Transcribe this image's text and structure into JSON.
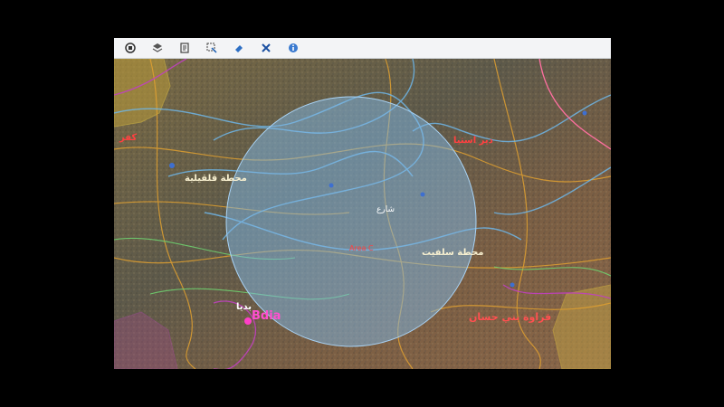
{
  "toolbar": {
    "tools": [
      {
        "icon": "home-icon"
      },
      {
        "icon": "layers-icon"
      },
      {
        "icon": "document-icon"
      },
      {
        "icon": "select-icon"
      },
      {
        "icon": "eraser-icon"
      },
      {
        "icon": "close-icon"
      },
      {
        "icon": "info-icon"
      }
    ]
  },
  "map": {
    "labels": {
      "kafr": "كفر",
      "mahatta_qalqilya": "محطة قلقيلية",
      "deir_istiya": "دير استيا",
      "shari": "شارع",
      "mahatta_salfit": "محطة سلفيت",
      "red_small": "Area C",
      "budya": "بديا",
      "budya_en": "Bdia",
      "qarawat": "قراوة بني حسان"
    },
    "colors": {
      "buffer_fill": "#7fb8e6",
      "road": "#e0a030",
      "contour": "#6eb6e8",
      "boundary": "#c040c0",
      "green": "#6fd06f",
      "urban": "#e0c040"
    }
  }
}
